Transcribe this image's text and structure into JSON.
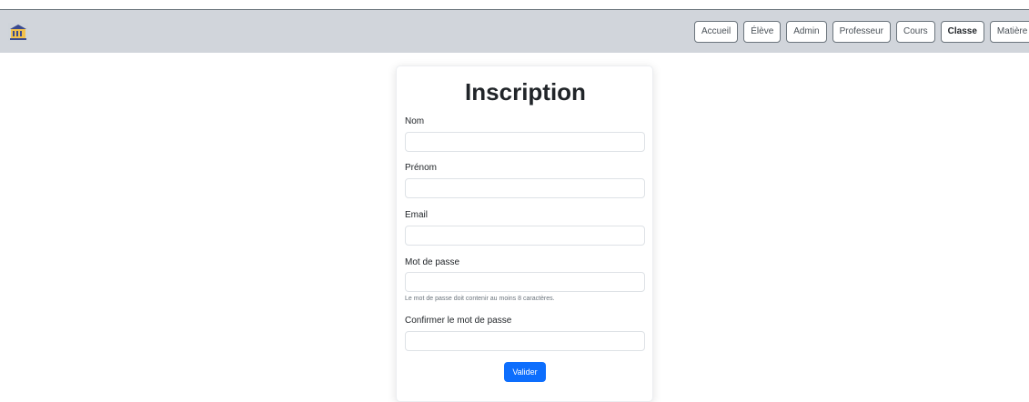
{
  "navbar": {
    "logo_icon": "school-building-icon",
    "items": [
      {
        "label": "Accueil"
      },
      {
        "label": "Élève"
      },
      {
        "label": "Admin"
      },
      {
        "label": "Professeur"
      },
      {
        "label": "Cours"
      },
      {
        "label": "Classe"
      },
      {
        "label": "Matière"
      }
    ],
    "active_item": "Classe",
    "background": "#d1d5db"
  },
  "form": {
    "title": "Inscription",
    "fields": {
      "nom": {
        "label": "Nom",
        "value": "",
        "placeholder": ""
      },
      "prenom": {
        "label": "Prénom",
        "value": "",
        "placeholder": ""
      },
      "email": {
        "label": "Email",
        "value": "",
        "placeholder": ""
      },
      "password": {
        "label": "Mot de passe",
        "value": "",
        "placeholder": "",
        "help": "Le mot de passe doit contenir au moins 8 caractères."
      },
      "confirm": {
        "label": "Confirmer le mot de passe",
        "value": "",
        "placeholder": ""
      }
    },
    "submit_label": "Valider",
    "submit_color": "#0d6efd"
  }
}
